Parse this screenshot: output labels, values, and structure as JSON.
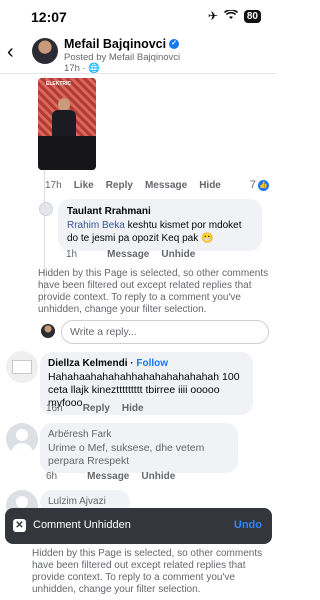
{
  "status_bar": {
    "time": "12:07",
    "battery": "80"
  },
  "header": {
    "title": "Mefail Bajqinovci",
    "subtitle": "Posted by Mefail Bajqinovci",
    "meta": "17h · "
  },
  "photo_comment": {
    "photo_caption": "ELEKTRIC",
    "time": "17h",
    "like_label": "Like",
    "reply_label": "Reply",
    "message_label": "Message",
    "hide_label": "Hide",
    "reaction_count": "7"
  },
  "reply_taulant": {
    "name": "Taulant Rrahmani",
    "mention": "Rrahim Beka",
    "text": " keshtu kismet  por mdoket do te jesmi pa opozit Keq pak 😬",
    "time": "1h",
    "message_label": "Message",
    "unhide_label": "Unhide"
  },
  "filter_notice_1": "Hidden by this Page is selected, so other comments have been filtered out except related replies that provide context. To reply to a comment you've unhidden, change your filter selection.",
  "reply_input": {
    "placeholder": "Write a reply..."
  },
  "comment_diellza": {
    "name": "Diellza Kelmendi",
    "follow_label": "Follow",
    "separator": " · ",
    "text": "Hahahaahahahahhahahahahahahah 100 ceta llajk kinezttttttttt tbirree iiii ooooo myfooo",
    "time": "16h",
    "reply_label": "Reply",
    "hide_label": "Hide"
  },
  "comment_arberesh": {
    "name": "Arbëresh Fark",
    "text": "Urime o Mef, suksese, dhe vetem perpara Rrespekt",
    "time": "6h",
    "message_label": "Message",
    "unhide_label": "Unhide"
  },
  "comment_lulzim": {
    "name": "Lulzim Ajvazi"
  },
  "toast": {
    "text": "Comment Unhidden",
    "undo_label": "Undo"
  },
  "filter_notice_2": "Hidden by this Page is selected, so other comments have been filtered out except related replies that provide context. To reply to a comment you've unhidden, change your filter selection."
}
